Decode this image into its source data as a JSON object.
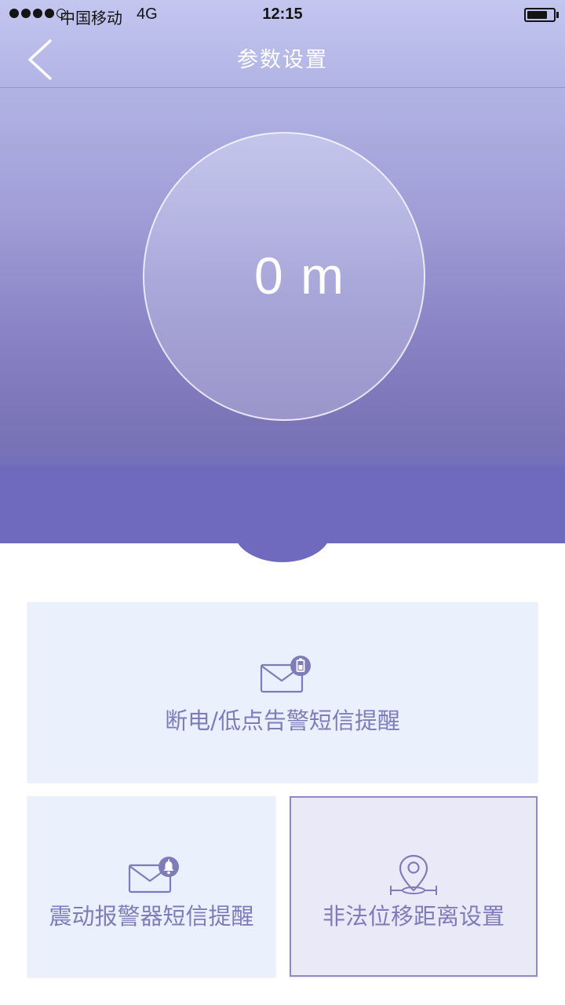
{
  "status_bar": {
    "carrier": "中国移动",
    "network": "4G",
    "time": "12:15",
    "signal_bars_filled": 4,
    "signal_bars_total": 5,
    "battery_level": 0.78
  },
  "nav": {
    "title": "参数设置",
    "back_icon": "chevron-left-icon"
  },
  "distance": {
    "value": "0 m"
  },
  "cards": {
    "power": {
      "label": "断电/低点告警短信提醒",
      "icon": "mail-battery-icon"
    },
    "vibration": {
      "label": "震动报警器短信提醒",
      "icon": "mail-bell-icon"
    },
    "displacement": {
      "label": "非法位移距离设置",
      "icon": "location-pin-icon",
      "selected": true
    }
  },
  "colors": {
    "accent": "#6f6abd",
    "card_background": "#eaf1fc",
    "card_text": "#807cba",
    "selected_border": "#8f89c8"
  }
}
